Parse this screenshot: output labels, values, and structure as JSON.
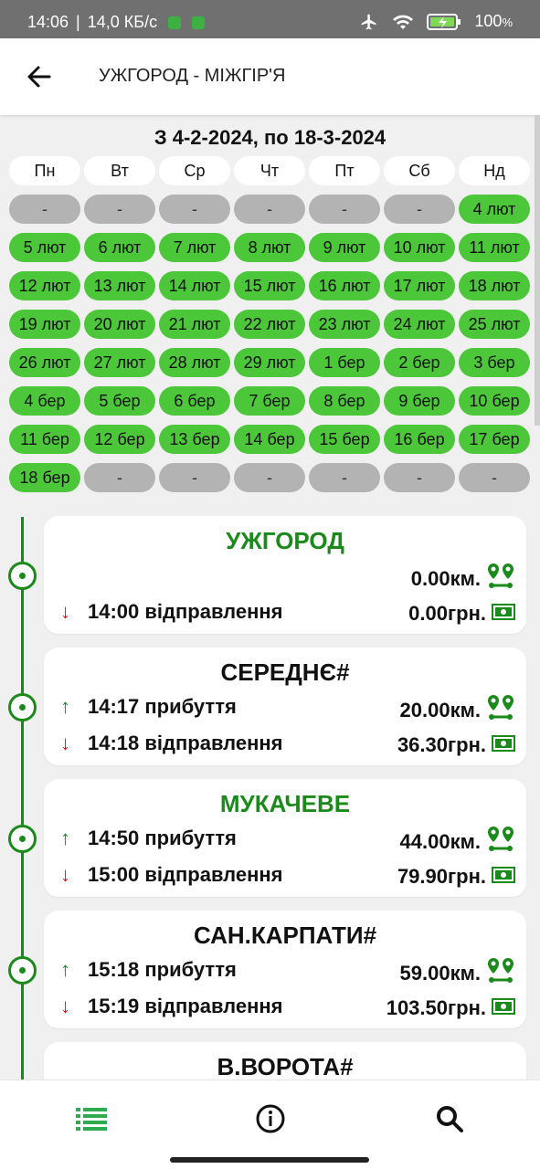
{
  "status": {
    "time": "14:06",
    "net_speed": "14,0 КБ/с",
    "battery": "100",
    "battery_unit": "%"
  },
  "appbar": {
    "title": "УЖГОРОД - МІЖГІР'Я"
  },
  "calendar": {
    "range": "З 4-2-2024, по 18-3-2024",
    "weekdays": [
      "Пн",
      "Вт",
      "Ср",
      "Чт",
      "Пт",
      "Сб",
      "Нд"
    ],
    "rows": [
      [
        "-",
        "-",
        "-",
        "-",
        "-",
        "-",
        "4 лют"
      ],
      [
        "5 лют",
        "6 лют",
        "7 лют",
        "8 лют",
        "9 лют",
        "10 лют",
        "11 лют"
      ],
      [
        "12 лют",
        "13 лют",
        "14 лют",
        "15 лют",
        "16 лют",
        "17 лют",
        "18 лют"
      ],
      [
        "19 лют",
        "20 лют",
        "21 лют",
        "22 лют",
        "23 лют",
        "24 лют",
        "25 лют"
      ],
      [
        "26 лют",
        "27 лют",
        "28 лют",
        "29 лют",
        "1 бер",
        "2 бер",
        "3 бер"
      ],
      [
        "4 бер",
        "5 бер",
        "6 бер",
        "7 бер",
        "8 бер",
        "9 бер",
        "10 бер"
      ],
      [
        "11 бер",
        "12 бер",
        "13 бер",
        "14 бер",
        "15 бер",
        "16 бер",
        "17 бер"
      ],
      [
        "18 бер",
        "-",
        "-",
        "-",
        "-",
        "-",
        "-"
      ]
    ]
  },
  "stops": [
    {
      "name": "УЖГОРОД",
      "green": true,
      "arrival": "",
      "departure": "14:00 відправлення",
      "km": "0.00км.",
      "price": "0.00грн."
    },
    {
      "name": "СЕРЕДНЄ#",
      "green": false,
      "arrival": "14:17 прибуття",
      "departure": "14:18 відправлення",
      "km": "20.00км.",
      "price": "36.30грн."
    },
    {
      "name": "МУКАЧЕВЕ",
      "green": true,
      "arrival": "14:50 прибуття",
      "departure": "15:00 відправлення",
      "km": "44.00км.",
      "price": "79.90грн."
    },
    {
      "name": "САН.КАРПАТИ#",
      "green": false,
      "arrival": "15:18 прибуття",
      "departure": "15:19 відправлення",
      "km": "59.00км.",
      "price": "103.50грн."
    },
    {
      "name": "В.ВОРОТА#",
      "green": false,
      "arrival": "",
      "departure": "",
      "km": "",
      "price": ""
    }
  ],
  "icons": {
    "back": "arrow-left-icon",
    "route": "route-pins-icon",
    "money": "banknote-icon",
    "list": "list-icon",
    "info": "info-icon",
    "search": "search-icon",
    "accent": "#1a8a1a",
    "day_green": "#4cc73a"
  }
}
